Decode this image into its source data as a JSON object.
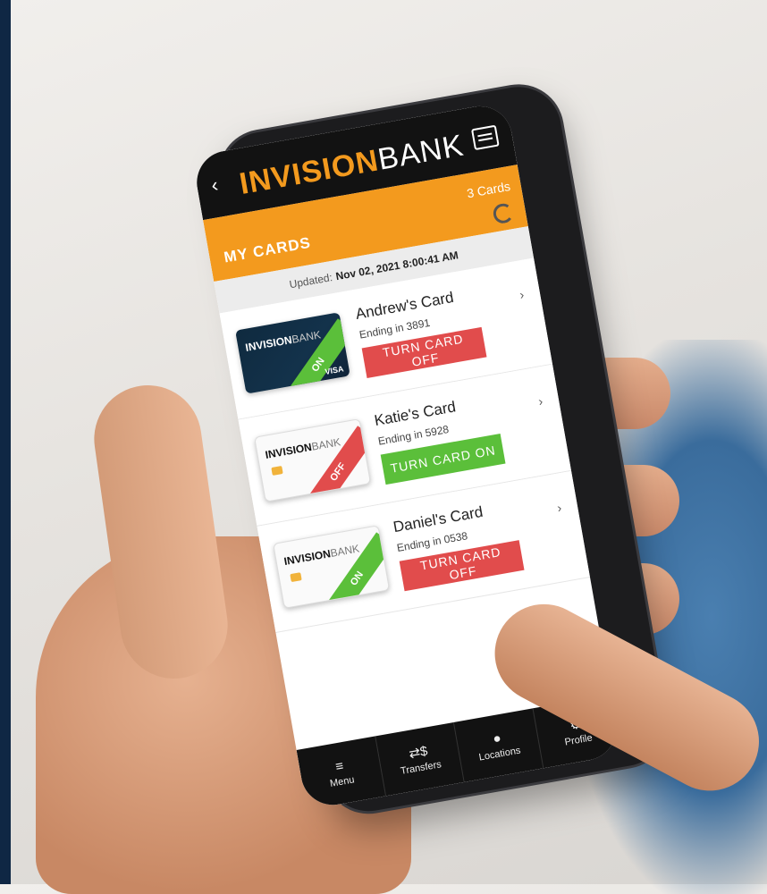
{
  "app": {
    "logo_bold": "INVISION",
    "logo_rest": "BANK",
    "back_glyph": "‹"
  },
  "cards_section": {
    "title": "MY CARDS",
    "count": "3 Cards",
    "updated_label": "Updated:",
    "updated_value": "Nov 02, 2021 8:00:41 AM"
  },
  "cards": [
    {
      "name": "Andrew's Card",
      "ending": "Ending in 3891",
      "button": "TURN CARD OFF",
      "ribbon": "ON",
      "logo_bold": "INVISION",
      "logo_rest": "BANK",
      "network": "VISA"
    },
    {
      "name": "Katie's Card",
      "ending": "Ending in 5928",
      "button": "TURN CARD ON",
      "ribbon": "OFF",
      "logo_bold": "INVISION",
      "logo_rest": "BANK"
    },
    {
      "name": "Daniel's Card",
      "ending": "Ending in 0538",
      "button": "TURN CARD OFF",
      "ribbon": "ON",
      "logo_bold": "INVISION",
      "logo_rest": "BANK"
    }
  ],
  "nav": [
    {
      "label": "Menu",
      "icon": "menu-icon"
    },
    {
      "label": "Transfers",
      "icon": "transfer-icon"
    },
    {
      "label": "Locations",
      "icon": "location-pin-icon"
    },
    {
      "label": "Profile",
      "icon": "gear-icon"
    }
  ],
  "colors": {
    "brand_orange": "#f39a1e",
    "on_green": "#5bbf3a",
    "off_red": "#e14c4c",
    "header_black": "#121212"
  }
}
